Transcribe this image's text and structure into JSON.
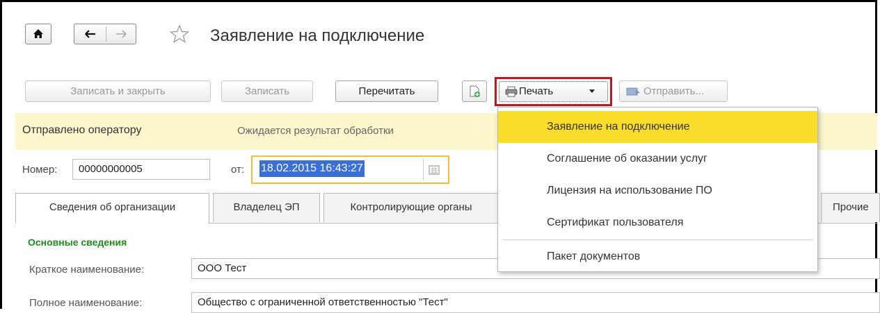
{
  "window": {
    "title": "Заявление на подключение"
  },
  "toolbar": {
    "save_close": "Записать и закрыть",
    "save": "Записать",
    "reread": "Перечитать",
    "print": "Печать",
    "send": "Отправить..."
  },
  "status": {
    "state": "Отправлено оператору",
    "info": "Ожидается результат обработки"
  },
  "doc": {
    "number_label": "Номер:",
    "number": "00000000005",
    "date_label": "от:",
    "date": "18.02.2015 16:43:27"
  },
  "tabs": [
    "Сведения об организации",
    "Владелец ЭП",
    "Контролирующие органы",
    "Прочие"
  ],
  "section": {
    "title": "Основные сведения",
    "short_name_label": "Краткое наименование:",
    "short_name": "ООО Тест",
    "full_name_label": "Полное наименование:",
    "full_name": "Общество с ограниченной ответственностью \"Тест\""
  },
  "print_menu": {
    "items": [
      "Заявление на подключение",
      "Соглашение об оказании услуг",
      "Лицензия на использование ПО",
      "Сертификат пользователя",
      "Пакет документов"
    ]
  },
  "colors": {
    "highlight": "#fadc2a",
    "banner": "#fcf6cd",
    "section_title": "#1a8f1a",
    "focus_border": "#c0161d",
    "date_focus": "#f0c030"
  }
}
